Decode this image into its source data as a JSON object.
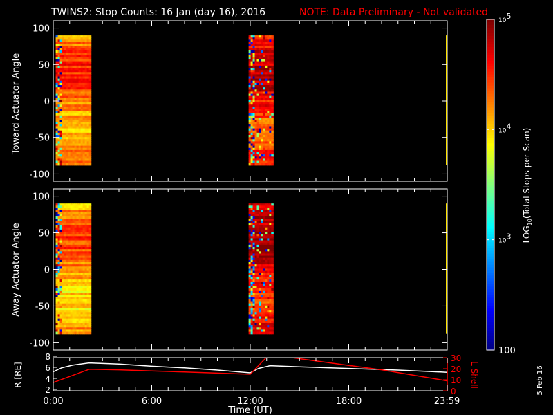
{
  "title": {
    "main": "TWINS2: Stop Counts: 16 Jan (day  16), 2016",
    "note": "NOTE: Data Preliminary - Not validated"
  },
  "footer_date": "5 Feb 16",
  "colors": {
    "note": "#ff0000",
    "axis": "#ffffff",
    "lshell": "#ff0000",
    "r_line": "#ffffff"
  },
  "chart_data": [
    {
      "type": "heatmap",
      "name": "toward",
      "ylabel": "Toward Actuator Angle",
      "ylim": [
        -110,
        110
      ],
      "yticks": [
        "100",
        "50",
        "0",
        "-50",
        "-100"
      ],
      "ytick_values": [
        100,
        50,
        0,
        -50,
        -100
      ],
      "xlim_hours": [
        0,
        24
      ],
      "data_intervals_hours": [
        [
          0.15,
          2.3
        ],
        [
          11.9,
          13.4
        ]
      ],
      "angle_range": [
        -88,
        90
      ],
      "value_scale": "log10",
      "value_range": [
        100,
        100000
      ],
      "dominant_level": {
        "first_interval": 4.3,
        "second_interval": 4.6
      }
    },
    {
      "type": "heatmap",
      "name": "away",
      "ylabel": "Away Actuator Angle",
      "ylim": [
        -110,
        110
      ],
      "yticks": [
        "100",
        "50",
        "0",
        "-50",
        "-100"
      ],
      "ytick_values": [
        100,
        50,
        0,
        -50,
        -100
      ],
      "xlim_hours": [
        0,
        24
      ],
      "data_intervals_hours": [
        [
          0.15,
          2.3
        ],
        [
          11.9,
          13.4
        ]
      ],
      "angle_range": [
        -88,
        90
      ],
      "value_scale": "log10",
      "value_range": [
        100,
        100000
      ],
      "dominant_level": {
        "first_interval": 4.2,
        "second_interval": 4.7
      }
    },
    {
      "type": "line",
      "name": "ephemeris",
      "xlabel": "Time (UT)",
      "xticks": [
        "0:00",
        "6:00",
        "12:00",
        "18:00",
        "23:59"
      ],
      "xtick_values": [
        0,
        6,
        12,
        18,
        23.98
      ],
      "ylabel_left": "R [RE]",
      "ylim_left": [
        2,
        8
      ],
      "yticks_left": [
        "8",
        "6",
        "4",
        "2"
      ],
      "ytick_left_values": [
        8,
        6,
        4,
        2
      ],
      "ylabel_right": "L Shell",
      "ylim_right": [
        0,
        30
      ],
      "yticks_right": [
        "30",
        "20",
        "10",
        "0"
      ],
      "ytick_right_values": [
        30,
        20,
        10,
        0
      ],
      "series": [
        {
          "name": "R",
          "axis": "left",
          "x": [
            0,
            0.5,
            1.2,
            2.2,
            4,
            6,
            8,
            10,
            12,
            12.5,
            13.2,
            15,
            18,
            21,
            24
          ],
          "y": [
            5.2,
            5.9,
            6.4,
            6.8,
            6.6,
            6.2,
            5.9,
            5.5,
            5.0,
            5.8,
            6.3,
            6.1,
            5.8,
            5.5,
            5.1
          ]
        },
        {
          "name": "L Shell",
          "axis": "right",
          "x": [
            0,
            2.2,
            4,
            6,
            8,
            10,
            12,
            13,
            14.3,
            16,
            18,
            20,
            22,
            24
          ],
          "y": [
            7.5,
            19.5,
            19,
            18,
            17,
            16,
            15,
            30.5,
            30.5,
            27,
            23,
            19,
            14,
            9
          ]
        }
      ]
    },
    {
      "type": "colorbar",
      "label": "LOG10(Total Stops per Scan)",
      "label_main": "LOG",
      "label_sub": "10",
      "label_rest": "(Total Stops per Scan)",
      "ticks": [
        {
          "base": "10",
          "exp": "5"
        },
        {
          "base": "10",
          "exp": "4"
        },
        {
          "base": "10",
          "exp": "3"
        }
      ],
      "tick_values": [
        100000,
        10000,
        1000
      ],
      "bottom_label": "100",
      "range": [
        100,
        100000
      ]
    }
  ]
}
